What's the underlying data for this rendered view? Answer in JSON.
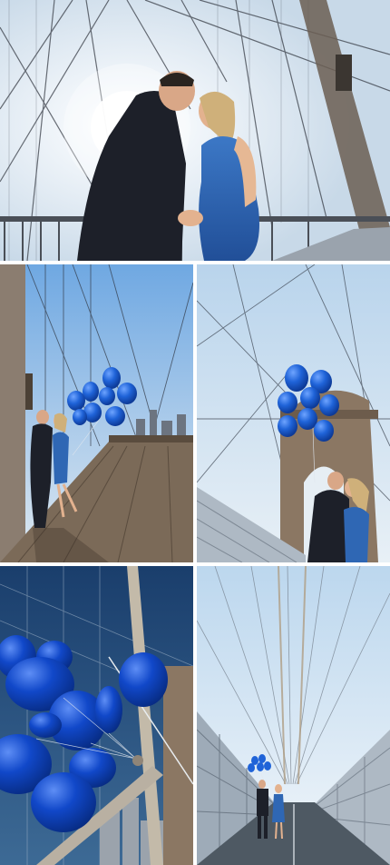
{
  "collage": {
    "background": "#ffffff",
    "photos": [
      {
        "id": "photo-1",
        "subject": "couple-kissing-on-bridge-walkway",
        "palette": {
          "sky": "#dfeaf3",
          "dress": "#2f67b4",
          "suit": "#1f2430"
        }
      },
      {
        "id": "photo-2",
        "subject": "couple-with-blue-balloons-on-bridge",
        "palette": {
          "sky": "#7fb4e6",
          "balloons": "#1f63d8",
          "deck": "#7b6a58"
        }
      },
      {
        "id": "photo-3",
        "subject": "couple-kissing-under-balloons-by-tower",
        "palette": {
          "sky": "#c9dff0",
          "balloons": "#1d6be0",
          "tower": "#8b7763"
        }
      },
      {
        "id": "photo-4",
        "subject": "closeup-blue-balloons-tied-to-cable",
        "palette": {
          "sky": "#214a7a",
          "balloons": "#1148c9",
          "cable": "#b9b0a2"
        }
      },
      {
        "id": "photo-5",
        "subject": "couple-walking-on-bridge-promenade",
        "palette": {
          "sky": "#cfe4f4",
          "fence": "#aeb9c4",
          "path": "#4e5963"
        }
      }
    ]
  }
}
